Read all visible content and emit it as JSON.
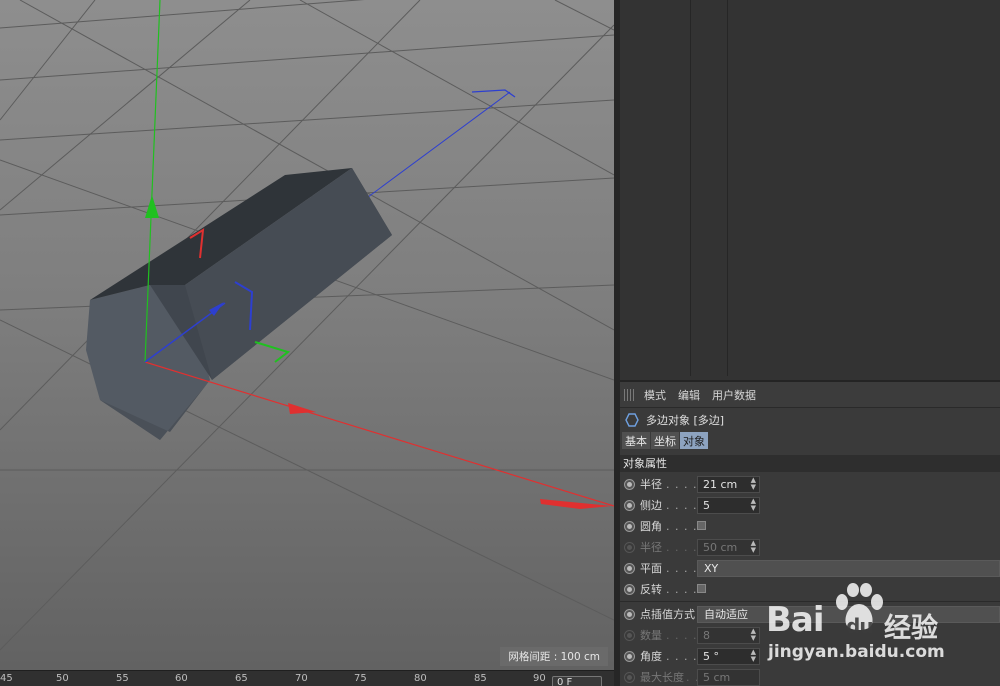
{
  "viewport": {
    "grid_spacing": "网格间距 : 100 cm"
  },
  "timeline": {
    "ticks": [
      "45",
      "50",
      "55",
      "60",
      "65",
      "70",
      "75",
      "80",
      "85",
      "90"
    ],
    "frame_field": "0 F"
  },
  "attributes": {
    "menu": [
      "模式",
      "编辑",
      "用户数据"
    ],
    "object_title": "多边对象 [多边]",
    "tabs": [
      "基本",
      "坐标",
      "对象"
    ],
    "active_tab": "对象",
    "section_title": "对象属性",
    "rows": [
      {
        "label": "半径",
        "dots": ". . . . .",
        "value": "21 cm",
        "enabled": true
      },
      {
        "label": "侧边",
        "dots": ". . . . .",
        "value": "5",
        "enabled": true
      },
      {
        "label": "圆角",
        "dots": ". . . . .",
        "enabled": true
      },
      {
        "label": "半径",
        "dots": ". . . . .",
        "value": "50 cm",
        "enabled": false
      },
      {
        "label": "平面",
        "dots": ". . . . .",
        "value": "XY",
        "enabled": true
      },
      {
        "label": "反转",
        "dots": ". . . . .",
        "enabled": true
      },
      {
        "label": "点插值方式",
        "value": "自动适应",
        "enabled": true
      },
      {
        "label": "数量",
        "dots": ". . . . .",
        "value": "8",
        "enabled": false
      },
      {
        "label": "角度",
        "dots": ". . . . .",
        "value": "5 °",
        "enabled": true
      },
      {
        "label": "最大长度",
        "dots": ". . .",
        "value": "5 cm",
        "enabled": false
      }
    ]
  },
  "watermark": {
    "brand": "Bai",
    "brand2": "du",
    "brand_cn": "经验",
    "url": "jingyan.baidu.com"
  },
  "colors": {
    "x_axis": "#e03030",
    "y_axis": "#20c020",
    "z_axis": "#2d3fd0",
    "active_tab": "#8da3c0"
  }
}
